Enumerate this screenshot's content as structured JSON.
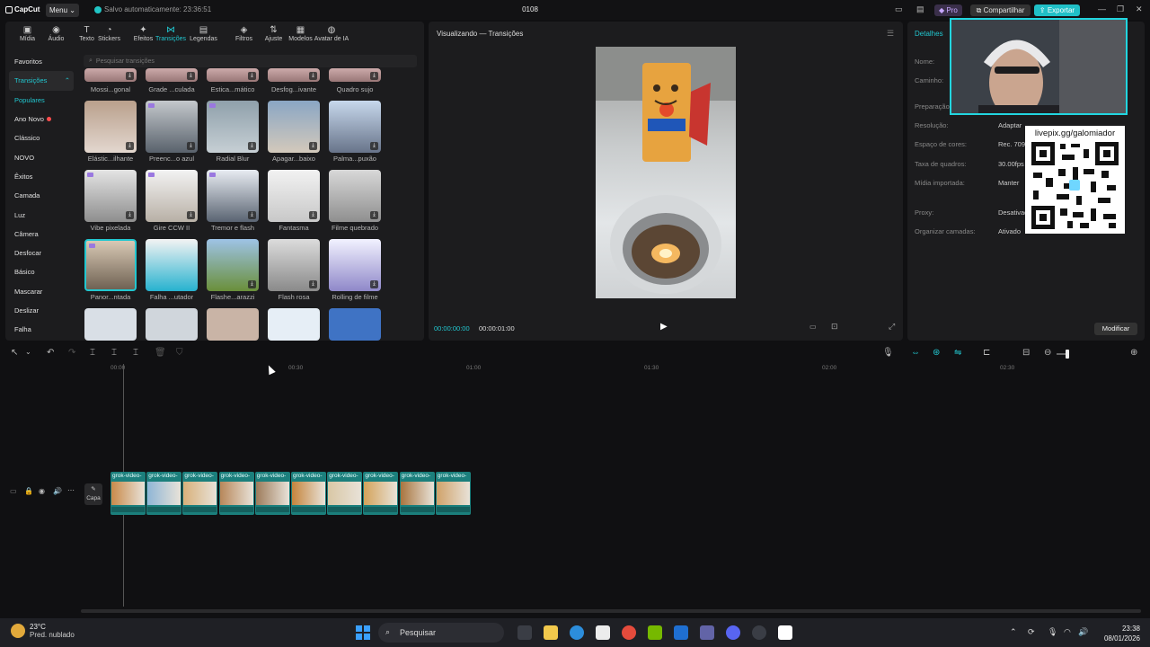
{
  "app": {
    "logo": "CapCut",
    "menu": "Menu",
    "autosave": "Salvo automaticamente: 23:36:51",
    "project_name": "0108",
    "pro": "Pro",
    "share": "Compartilhar",
    "export": "Exportar"
  },
  "toolbar": [
    {
      "label": "Mídia",
      "icon": "media-icon"
    },
    {
      "label": "Áudio",
      "icon": "audio-icon"
    },
    {
      "label": "Texto",
      "icon": "text-icon"
    },
    {
      "label": "Stickers",
      "icon": "sticker-icon"
    },
    {
      "label": "Efeitos",
      "icon": "effects-icon"
    },
    {
      "label": "Transições",
      "icon": "transitions-icon",
      "active": true
    },
    {
      "label": "Legendas",
      "icon": "captions-icon"
    },
    {
      "label": "Filtros",
      "icon": "filters-icon"
    },
    {
      "label": "Ajuste",
      "icon": "adjust-icon"
    },
    {
      "label": "Modelos",
      "icon": "templates-icon"
    },
    {
      "label": "Avatar de IA",
      "icon": "ai-avatar-icon"
    }
  ],
  "categories": [
    "Favoritos",
    "Transições",
    "Populares",
    "Ano Novo",
    "Clássico",
    "NOVO",
    "Êxitos",
    "Camada",
    "Luz",
    "Câmera",
    "Desfocar",
    "Básico",
    "Mascarar",
    "Deslizar",
    "Falha"
  ],
  "search_placeholder": "Pesquisar transições",
  "transitions_row0": [
    "Mossi...gonal",
    "Grade ...culada",
    "Estica...mático",
    "Desfog...ivante",
    "Quadro sujo"
  ],
  "transitions": [
    "Elástic...ilhante",
    "Preenc...o azul",
    "Radial Blur",
    "Apagar...baixo",
    "Palma...puxão",
    "Vibe pixelada",
    "Gire CCW II",
    "Tremor e flash",
    "Fantasma",
    "Filme quebrado",
    "Panor...ntada",
    "Falha ...utador",
    "Flashe...arazzi",
    "Flash rosa",
    "Rolling de filme"
  ],
  "preview": {
    "title": "Visualizando — Transições",
    "timecode_current": "00:00:00:00",
    "timecode_total": "00:00:01:00"
  },
  "details": {
    "tab": "Detalhes",
    "labels": [
      "Nome:",
      "Caminho:",
      "Preparação:",
      "Resolução:",
      "Espaço de cores:",
      "Taxa de quadros:",
      "Mídia importada:",
      "Proxy:",
      "Organizar camadas:"
    ],
    "values": [
      "",
      "",
      "",
      "Adaptar",
      "Rec. 709",
      "30.00fps",
      "Manter",
      "Desativado",
      "Ativado"
    ],
    "modify": "Modificar"
  },
  "overlay": {
    "livepix": "livepix.gg/galomiador"
  },
  "ruler": [
    "00:00",
    "00:30",
    "01:00",
    "01:30",
    "02:00",
    "02:30"
  ],
  "track": {
    "cover": "Capa",
    "clip_name": "grok-video-"
  },
  "taskbar": {
    "temp": "23°C",
    "weather": "Pred. nublado",
    "search": "Pesquisar",
    "time": "23:38",
    "date": "08/01/2026"
  }
}
